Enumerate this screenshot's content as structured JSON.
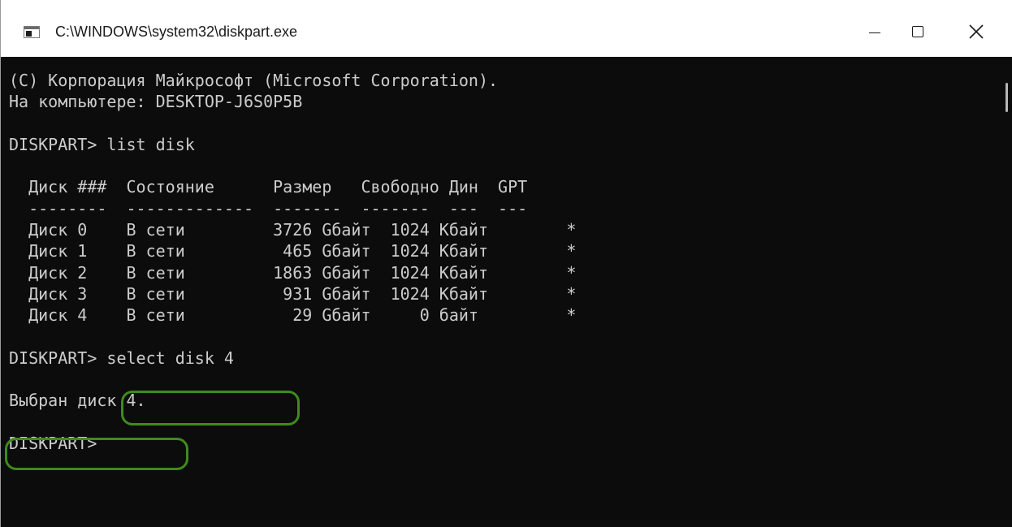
{
  "window": {
    "title": "C:\\WINDOWS\\system32\\diskpart.exe",
    "controls": {
      "minimize": "minimize-icon",
      "maximize": "maximize-icon",
      "close": "close-icon"
    }
  },
  "console": {
    "lines": [
      "(C) Корпорация Майкрософт (Microsoft Corporation).",
      "На компьютере: DESKTOP-J6S0P5B",
      "",
      "DISKPART> list disk",
      "",
      "  Диск ###  Состояние      Размер   Свободно Дин  GPT",
      "  --------  -------------  -------  -------  ---  ---",
      "  Диск 0    В сети         3726 Gбайт  1024 Kбайт        *",
      "  Диск 1    В сети          465 Gбайт  1024 Kбайт        *",
      "  Диск 2    В сети         1863 Gбайт  1024 Kбайт        *",
      "  Диск 3    В сети          931 Gбайт  1024 Kбайт        *",
      "  Диск 4    В сети           29 Gбайт     0 байт         *",
      "",
      "DISKPART> select disk 4",
      "",
      "Выбран диск 4.",
      "",
      "DISKPART> "
    ]
  },
  "colors": {
    "console_bg": "#0c0c0c",
    "console_fg": "#cccccc",
    "highlight": "#3f8a1e"
  }
}
